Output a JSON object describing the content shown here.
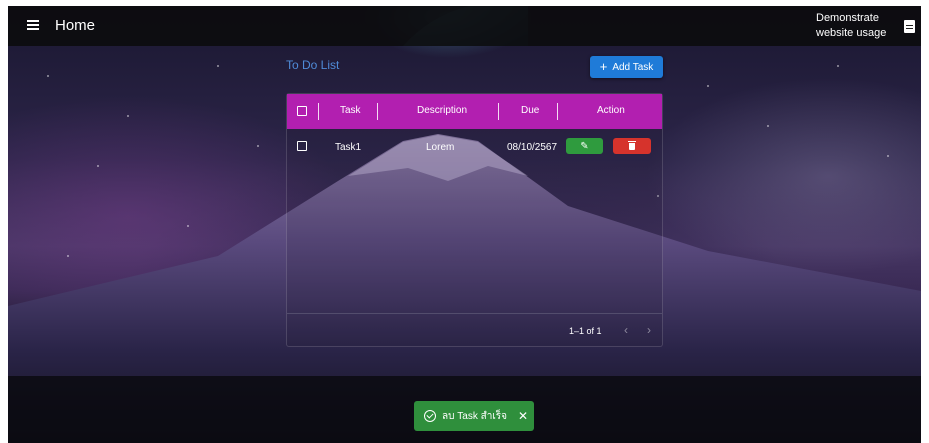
{
  "appbar": {
    "title": "Home",
    "right_text": "Demonstrate website usage",
    "menu_icon": "hamburger-menu-icon",
    "doc_icon": "document-icon"
  },
  "todo": {
    "title": "To Do List",
    "add_button": "Add Task",
    "add_icon": "plus-icon"
  },
  "table": {
    "headers": [
      "Task",
      "Description",
      "Due",
      "Action"
    ],
    "rows": [
      {
        "task": "Task1",
        "description": "Lorem",
        "due": "08/10/2567"
      }
    ],
    "pagination": "1–1 of 1",
    "header_color": "#b21fb0"
  },
  "snackbar": {
    "message": "ลบ Task สำเร็จ",
    "close": "✕",
    "color": "#2f8f3c"
  },
  "colors": {
    "primary": "#1f7bd8",
    "edit": "#2f9b3e",
    "delete": "#d6332c"
  }
}
